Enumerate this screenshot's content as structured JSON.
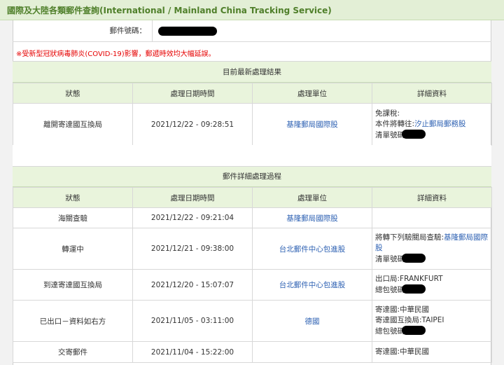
{
  "title": "國際及大陸各類郵件查詢(International / Mainland China Tracking Service)",
  "mail_number_label": "郵件號碼：",
  "notice": "※受新型冠狀病毒肺炎(COVID-19)影響，郵遞時效均大幅延誤。",
  "latest": {
    "title": "目前最新處理結果",
    "headers": [
      "狀態",
      "處理日期時間",
      "處理單位",
      "詳細資料"
    ],
    "row": {
      "status": "離開寄達國互換局",
      "datetime": "2021/12/22 - 09:28:51",
      "unit": "基隆郵局國際股",
      "detail_line1": "免課稅:",
      "detail_line2_prefix": "本件將轉往:",
      "detail_line2_link": "汐止郵局郵務股",
      "detail_line3": "清單號碼"
    }
  },
  "history": {
    "title": "郵件詳細處理過程",
    "headers": [
      "狀態",
      "處理日期時間",
      "處理單位",
      "詳細資料"
    ],
    "rows": [
      {
        "status": "海關查驗",
        "datetime": "2021/12/22 - 09:21:04",
        "unit": "基隆郵局國際股"
      },
      {
        "status": "轉運中",
        "datetime": "2021/12/21 - 09:38:00",
        "unit": "台北郵件中心包進股",
        "detail_prefix": "將轉下列驗關局查驗:",
        "detail_link": "基隆郵局國際股",
        "detail_line2": "清單號碼"
      },
      {
        "status": "到達寄達國互換局",
        "datetime": "2021/12/20 - 15:07:07",
        "unit": "台北郵件中心包進股",
        "detail_line1": "出口局:FRANKFURT",
        "detail_line2": "總包號碼"
      },
      {
        "status": "已出口－資料如右方",
        "datetime": "2021/11/05 - 03:11:00",
        "unit": "德國",
        "detail_line1": "寄達國:中華民國",
        "detail_line2": "寄達國互換局:TAIPEI",
        "detail_line3": "總包號碼"
      },
      {
        "status": "交寄郵件",
        "datetime": "2021/11/04 - 15:22:00",
        "detail_line1": "寄達國:中華民國"
      }
    ]
  }
}
